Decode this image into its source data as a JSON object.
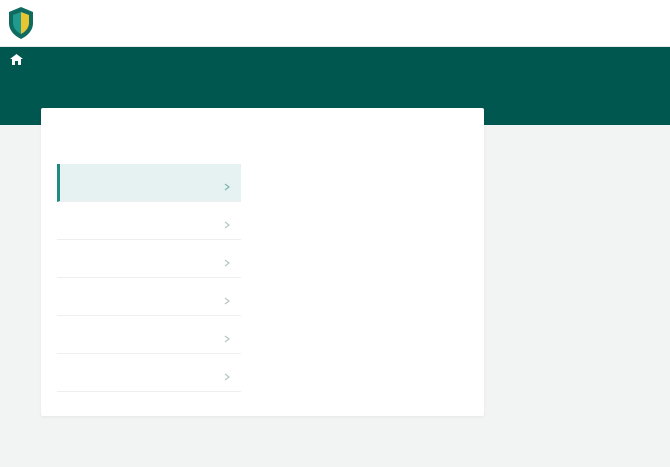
{
  "header": {
    "brand_name": "",
    "logo_icon": "shield-logo-icon"
  },
  "nav": {
    "home_icon": "home-icon",
    "items": [
      "",
      "",
      "",
      "",
      "",
      ""
    ],
    "sub_item": ""
  },
  "card": {
    "title": "",
    "faq": [
      {
        "label": "",
        "active": true
      },
      {
        "label": "",
        "active": false
      },
      {
        "label": "",
        "active": false
      },
      {
        "label": "",
        "active": false
      },
      {
        "label": "",
        "active": false
      },
      {
        "label": "",
        "active": false
      }
    ],
    "answer": {
      "title": "",
      "body": "",
      "blocks": [
        {
          "heading": "",
          "text": ""
        },
        {
          "heading": "",
          "text": ""
        }
      ]
    }
  },
  "colors": {
    "brand_green": "#00574f",
    "accent_teal": "#1f8a80",
    "page_bg": "#f2f4f4"
  }
}
